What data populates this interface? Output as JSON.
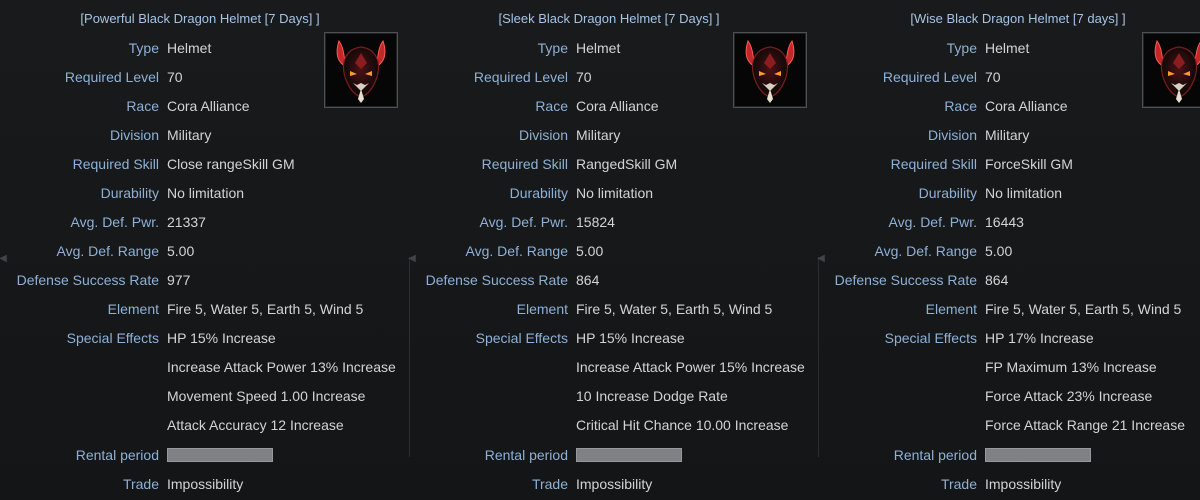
{
  "panels": [
    {
      "title": "[Powerful Black Dragon Helmet [7 Days] ]",
      "icon": "black-dragon-helmet-icon",
      "labels": {
        "type": "Type",
        "required_level": "Required Level",
        "race": "Race",
        "division": "Division",
        "required_skill": "Required Skill",
        "durability": "Durability",
        "avg_def_pwr": "Avg. Def. Pwr.",
        "avg_def_range": "Avg. Def. Range",
        "defense_success_rate": "Defense Success Rate",
        "element": "Element",
        "special_effects": "Special Effects",
        "rental_period": "Rental period",
        "trade": "Trade"
      },
      "values": {
        "type": "Helmet",
        "required_level": "70",
        "race": "Cora Alliance",
        "division": "Military",
        "required_skill": "Close rangeSkill GM",
        "durability": "No limitation",
        "avg_def_pwr": "21337",
        "avg_def_range": "5.00",
        "defense_success_rate": "977",
        "element": "Fire 5, Water 5, Earth 5, Wind 5",
        "trade": "Impossibility"
      },
      "special_effects": [
        "HP 15% Increase",
        "Increase Attack Power 13% Increase",
        "Movement Speed 1.00 Increase",
        "Attack Accuracy 12 Increase"
      ]
    },
    {
      "title": "[Sleek Black Dragon Helmet [7 Days] ]",
      "icon": "black-dragon-helmet-icon",
      "labels": {
        "type": "Type",
        "required_level": "Required Level",
        "race": "Race",
        "division": "Division",
        "required_skill": "Required Skill",
        "durability": "Durability",
        "avg_def_pwr": "Avg. Def. Pwr.",
        "avg_def_range": "Avg. Def. Range",
        "defense_success_rate": "Defense Success Rate",
        "element": "Element",
        "special_effects": "Special Effects",
        "rental_period": "Rental period",
        "trade": "Trade"
      },
      "values": {
        "type": "Helmet",
        "required_level": "70",
        "race": "Cora Alliance",
        "division": "Military",
        "required_skill": "RangedSkill GM",
        "durability": "No limitation",
        "avg_def_pwr": "15824",
        "avg_def_range": "5.00",
        "defense_success_rate": "864",
        "element": "Fire 5, Water 5, Earth 5, Wind 5",
        "trade": "Impossibility"
      },
      "special_effects": [
        "HP 15% Increase",
        "Increase Attack Power 15% Increase",
        "10 Increase Dodge Rate",
        "Critical Hit Chance 10.00 Increase"
      ]
    },
    {
      "title": "[Wise Black Dragon Helmet [7 days] ]",
      "icon": "black-dragon-helmet-icon",
      "labels": {
        "type": "Type",
        "required_level": "Required Level",
        "race": "Race",
        "division": "Division",
        "required_skill": "Required Skill",
        "durability": "Durability",
        "avg_def_pwr": "Avg. Def. Pwr.",
        "avg_def_range": "Avg. Def. Range",
        "defense_success_rate": "Defense Success Rate",
        "element": "Element",
        "special_effects": "Special Effects",
        "rental_period": "Rental period",
        "trade": "Trade"
      },
      "values": {
        "type": "Helmet",
        "required_level": "70",
        "race": "Cora Alliance",
        "division": "Military",
        "required_skill": "ForceSkill GM",
        "durability": "No limitation",
        "avg_def_pwr": "16443",
        "avg_def_range": "5.00",
        "defense_success_rate": "864",
        "element": "Fire 5, Water 5, Earth 5, Wind 5",
        "trade": "Impossibility"
      },
      "special_effects": [
        "HP 17% Increase",
        "FP Maximum 13% Increase",
        "Force Attack 23% Increase",
        "Force Attack Range 21 Increase"
      ]
    }
  ],
  "colors": {
    "background": "#151719",
    "title": "#a6c4e4",
    "label": "#8fb1d6",
    "value": "#d4d4d4",
    "rental_bar": "#7f8185",
    "helmet_red": "#c0282a",
    "helmet_eyes": "#ff9a2a"
  }
}
